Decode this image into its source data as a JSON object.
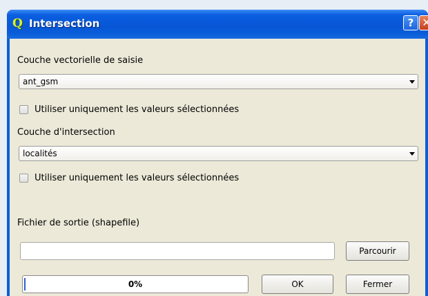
{
  "window": {
    "title": "Intersection",
    "app_icon_glyph": "Q",
    "help_glyph": "?",
    "close_glyph": "✕"
  },
  "form": {
    "input_layer_label": "Couche vectorielle de saisie",
    "input_layer_value": "ant_gsm",
    "input_selected_only_label": "Utiliser uniquement les valeurs sélectionnées",
    "input_selected_only_checked": false,
    "intersect_layer_label": "Couche d'intersection",
    "intersect_layer_value": "localités",
    "intersect_selected_only_label": "Utiliser uniquement les valeurs sélectionnées",
    "intersect_selected_only_checked": false,
    "output_label": "Fichier de sortie (shapefile)",
    "output_value": "",
    "browse_label": "Parcourir"
  },
  "footer": {
    "progress_text": "0%",
    "progress_fraction": 0.0,
    "ok_label": "OK",
    "close_label": "Fermer"
  },
  "colors": {
    "titlebar": "#0756d6",
    "client_bg": "#ece9d8",
    "progress_fill": "#2b63c8"
  }
}
